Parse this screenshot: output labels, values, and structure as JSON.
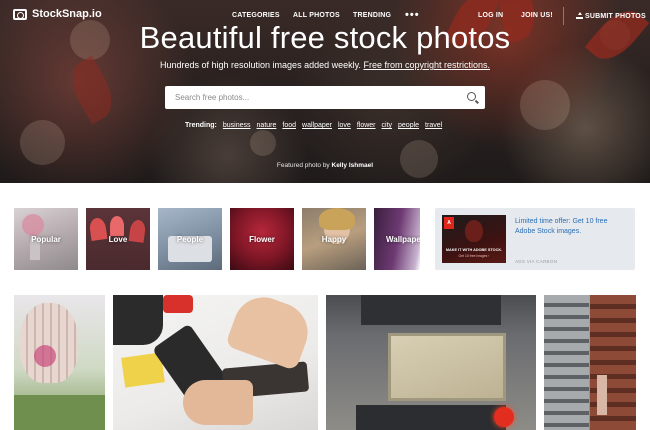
{
  "nav": {
    "logo": "StockSnap.io",
    "links": [
      "CATEGORIES",
      "ALL PHOTOS",
      "TRENDING"
    ],
    "more": "•••",
    "login": "LOG IN",
    "join": "JOIN US!",
    "submit": "SUBMIT PHOTOS"
  },
  "hero": {
    "title": "Beautiful free stock photos",
    "subtitle": "Hundreds of high resolution images added weekly.",
    "subtitle_link": "Free from copyright restrictions.",
    "featured_prefix": "Featured photo by",
    "featured_author": "Kelly Ishmael"
  },
  "search": {
    "placeholder": "Search free photos..."
  },
  "trending": {
    "label": "Trending:",
    "tags": [
      "business",
      "nature",
      "food",
      "wallpaper",
      "love",
      "flower",
      "city",
      "people",
      "travel"
    ]
  },
  "categories": [
    "Popular",
    "Love",
    "People",
    "Flower",
    "Happy",
    "Wallpaper"
  ],
  "ad": {
    "text": "Limited time offer: Get 10 free Adobe Stock images.",
    "image_line1": "MAKE IT WITH ADOBE STOCK.",
    "image_line2": "Get 10 free images ›",
    "via": "ADS VIA CARBON",
    "logo": "A"
  },
  "colors": {
    "accent_link": "#2b6fb6",
    "ad_background": "#e6e9ed"
  }
}
